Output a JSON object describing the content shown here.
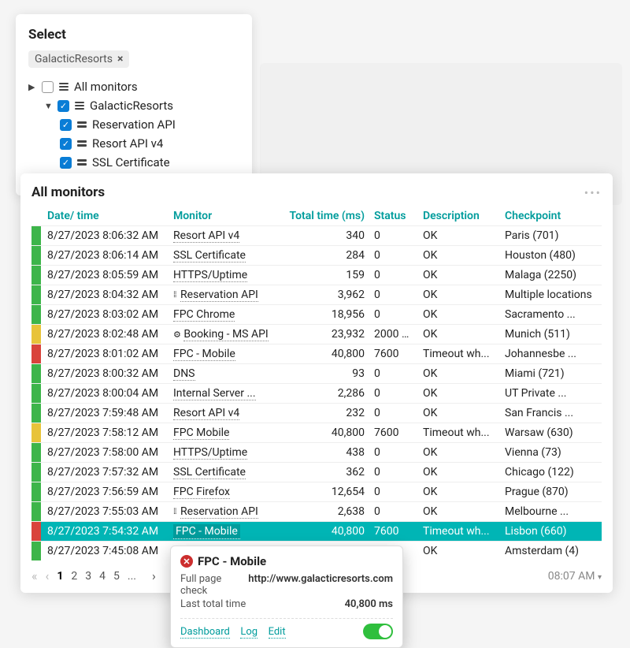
{
  "select": {
    "title": "Select",
    "chip": "GalacticResorts",
    "all": "All monitors",
    "group": "GalacticResorts",
    "leaves": [
      "Reservation API",
      "Resort API v4",
      "SSL Certificate"
    ]
  },
  "panel": {
    "title": "All monitors",
    "columns": {
      "date": "Date/ time",
      "monitor": "Monitor",
      "total": "Total time (ms)",
      "status": "Status",
      "desc": "Description",
      "checkpoint": "Checkpoint"
    },
    "rows": [
      {
        "color": "green",
        "date": "8/27/2023 8:06:32 AM",
        "mon": "Resort API v4",
        "total": "340",
        "status": "0",
        "desc": "OK",
        "cp": "Paris (701)"
      },
      {
        "color": "green",
        "date": "8/27/2023 8:06:14 AM",
        "mon": "SSL Certificate",
        "total": "284",
        "status": "0",
        "desc": "OK",
        "cp": "Houston (480)"
      },
      {
        "color": "green",
        "date": "8/27/2023 8:05:59 AM",
        "mon": "HTTPS/Uptime",
        "total": "159",
        "status": "0",
        "desc": "OK",
        "cp": "Malaga (2250)"
      },
      {
        "color": "green",
        "date": "8/27/2023 8:04:32 AM",
        "mon": "Reservation API",
        "total": "3,962",
        "status": "0",
        "desc": "OK",
        "cp": "Multiple locations",
        "icon": "dots"
      },
      {
        "color": "green",
        "date": "8/27/2023 8:03:02 AM",
        "mon": "FPC Chrome",
        "total": "18,956",
        "status": "0",
        "desc": "OK",
        "cp": "Sacramento ..."
      },
      {
        "color": "yellow",
        "date": "8/27/2023 8:02:48 AM",
        "mon": "Booking - MS API",
        "total": "23,932",
        "status": "2000",
        "desc": "OK",
        "cp": "Munich (511)",
        "icon": "gear",
        "camera": true
      },
      {
        "color": "red",
        "date": "8/27/2023 8:01:02 AM",
        "mon": "FPC - Mobile",
        "total": "40,800",
        "status": "7600",
        "desc": "Timeout wh...",
        "cp": "Johannesbe ..."
      },
      {
        "color": "green",
        "date": "8/27/2023 8:00:32 AM",
        "mon": "DNS",
        "total": "93",
        "status": "0",
        "desc": "OK",
        "cp": "Miami (721)"
      },
      {
        "color": "green",
        "date": "8/27/2023 8:00:04 AM",
        "mon": "Internal Server ...",
        "total": "2,286",
        "status": "0",
        "desc": "OK",
        "cp": "UT Private ..."
      },
      {
        "color": "green",
        "date": "8/27/2023 7:59:48 AM",
        "mon": "Resort API v4",
        "total": "232",
        "status": "0",
        "desc": "OK",
        "cp": "San Francis ..."
      },
      {
        "color": "yellow",
        "date": "8/27/2023 7:58:12 AM",
        "mon": "FPC Mobile",
        "total": "40,800",
        "status": "7600",
        "desc": "Timeout wh...",
        "cp": "Warsaw (630)"
      },
      {
        "color": "green",
        "date": "8/27/2023 7:58:00 AM",
        "mon": "HTTPS/Uptime",
        "total": "438",
        "status": "0",
        "desc": "OK",
        "cp": "Vienna (73)"
      },
      {
        "color": "green",
        "date": "8/27/2023 7:57:32 AM",
        "mon": "SSL Certificate",
        "total": "362",
        "status": "0",
        "desc": "OK",
        "cp": "Chicago (122)"
      },
      {
        "color": "green",
        "date": "8/27/2023 7:56:59 AM",
        "mon": "FPC Firefox",
        "total": "12,654",
        "status": "0",
        "desc": "OK",
        "cp": "Prague (870)"
      },
      {
        "color": "green",
        "date": "8/27/2023 7:55:03 AM",
        "mon": "Reservation API",
        "total": "2,638",
        "status": "0",
        "desc": "OK",
        "cp": "Melbourne ...",
        "icon": "dots"
      },
      {
        "color": "red",
        "date": "8/27/2023 7:54:32 AM",
        "mon": "FPC - Mobile",
        "total": "40,800",
        "status": "7600",
        "desc": "Timeout wh...",
        "cp": "Lisbon (660)",
        "selected": true
      },
      {
        "color": "green",
        "date": "8/27/2023 7:45:08 AM",
        "mon": "",
        "total": "",
        "status": "",
        "desc": "OK",
        "cp": "Amsterdam (4)"
      }
    ],
    "pages": [
      "1",
      "2",
      "3",
      "4",
      "5",
      "..."
    ],
    "time": "08:07 AM"
  },
  "popup": {
    "title": "FPC - Mobile",
    "check_label": "Full page check",
    "url": "http://www.galacticresorts.com",
    "last_label": "Last total time",
    "last_value": "40,800 ms",
    "links": {
      "dash": "Dashboard",
      "log": "Log",
      "edit": "Edit"
    }
  }
}
